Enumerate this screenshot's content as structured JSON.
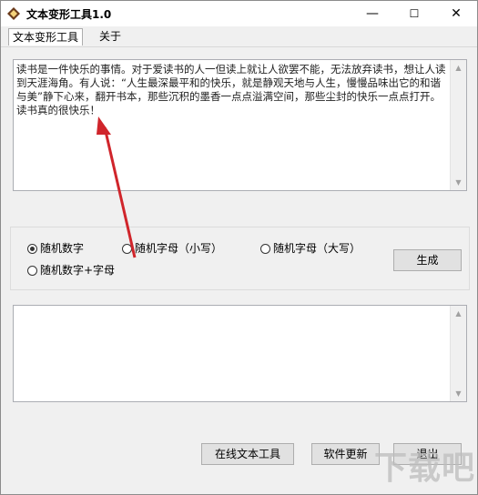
{
  "window": {
    "title": "文本变形工具1.0",
    "minimize": "—",
    "maximize": "☐",
    "close": "✕"
  },
  "menu": {
    "tab_text_transform": "文本变形工具",
    "tab_about": "关于"
  },
  "input": {
    "text": "读书是一件快乐的事情。对于爱读书的人一但读上就让人欲罢不能，无法放弃读书，想让人读到天涯海角。有人说：“人生最深最平和的快乐，就是静观天地与人生，慢慢品味出它的和谐与美”静下心来，翻开书本，那些沉积的墨香一点点溢满空间，那些尘封的快乐一点点打开。读书真的很快乐！"
  },
  "options": {
    "random_digits": "随机数字",
    "random_lowercase": "随机字母（小写）",
    "random_uppercase": "随机字母（大写）",
    "random_digits_letters": "随机数字+字母",
    "selected": "random_digits"
  },
  "buttons": {
    "generate": "生成",
    "online_tools": "在线文本工具",
    "software_update": "软件更新",
    "exit": "退出"
  },
  "output": {
    "text": ""
  },
  "watermark": "下载吧",
  "colors": {
    "arrow": "#d0252b",
    "window_bg": "#f0f0f0",
    "textarea_bg": "#ffffff"
  }
}
